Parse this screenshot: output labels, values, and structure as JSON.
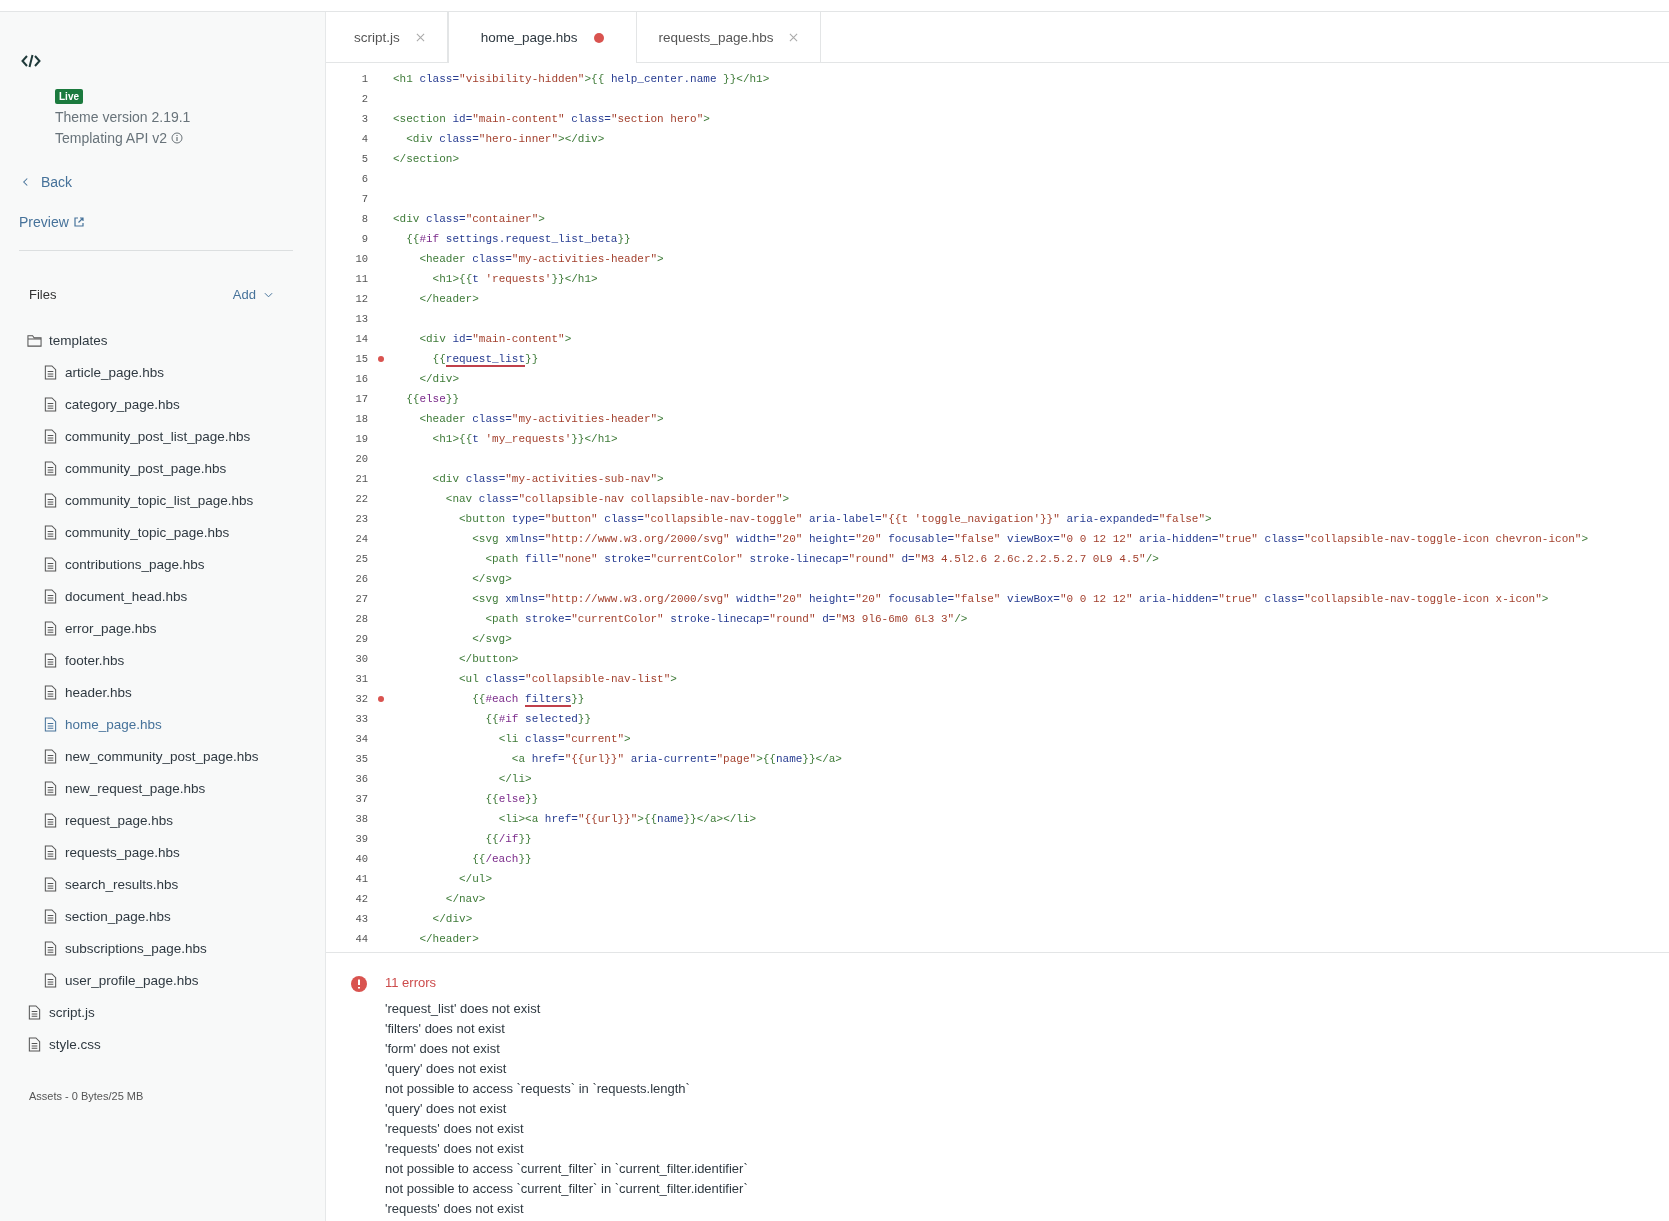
{
  "sidebar": {
    "badge": "Live",
    "theme_version": "Theme version 2.19.1",
    "api": "Templating API v2",
    "back": "Back",
    "preview": "Preview",
    "files": {
      "label": "Files",
      "add": "Add",
      "tree": [
        {
          "name": "templates",
          "kind": "folder",
          "selected": false,
          "children": [
            {
              "name": "article_page.hbs",
              "kind": "file",
              "selected": false
            },
            {
              "name": "category_page.hbs",
              "kind": "file",
              "selected": false
            },
            {
              "name": "community_post_list_page.hbs",
              "kind": "file",
              "selected": false
            },
            {
              "name": "community_post_page.hbs",
              "kind": "file",
              "selected": false
            },
            {
              "name": "community_topic_list_page.hbs",
              "kind": "file",
              "selected": false
            },
            {
              "name": "community_topic_page.hbs",
              "kind": "file",
              "selected": false
            },
            {
              "name": "contributions_page.hbs",
              "kind": "file",
              "selected": false
            },
            {
              "name": "document_head.hbs",
              "kind": "file",
              "selected": false
            },
            {
              "name": "error_page.hbs",
              "kind": "file",
              "selected": false
            },
            {
              "name": "footer.hbs",
              "kind": "file",
              "selected": false
            },
            {
              "name": "header.hbs",
              "kind": "file",
              "selected": false
            },
            {
              "name": "home_page.hbs",
              "kind": "file",
              "selected": true
            },
            {
              "name": "new_community_post_page.hbs",
              "kind": "file",
              "selected": false
            },
            {
              "name": "new_request_page.hbs",
              "kind": "file",
              "selected": false
            },
            {
              "name": "request_page.hbs",
              "kind": "file",
              "selected": false
            },
            {
              "name": "requests_page.hbs",
              "kind": "file",
              "selected": false
            },
            {
              "name": "search_results.hbs",
              "kind": "file",
              "selected": false
            },
            {
              "name": "section_page.hbs",
              "kind": "file",
              "selected": false
            },
            {
              "name": "subscriptions_page.hbs",
              "kind": "file",
              "selected": false
            },
            {
              "name": "user_profile_page.hbs",
              "kind": "file",
              "selected": false
            }
          ]
        },
        {
          "name": "script.js",
          "kind": "file",
          "selected": false
        },
        {
          "name": "style.css",
          "kind": "file",
          "selected": false
        }
      ]
    },
    "assets": "Assets - 0 Bytes/25 MB"
  },
  "tabs": [
    {
      "label": "script.js",
      "selected": false,
      "modified": false
    },
    {
      "label": "home_page.hbs",
      "selected": true,
      "modified": true
    },
    {
      "label": "requests_page.hbs",
      "selected": false,
      "modified": false
    }
  ],
  "editor": {
    "lines": [
      {
        "number": "1",
        "kind": "plain",
        "code": "<h1 class=\"visibility-hidden\">{{ help_center.name }}</h1>"
      },
      {
        "number": "2",
        "kind": "plain"
      },
      {
        "number": "3",
        "kind": "plain",
        "code": "<section id=\"main-content\" class=\"section hero\">"
      },
      {
        "number": "4",
        "kind": "plain",
        "code": "  <div class=\"hero-inner\"></div>"
      },
      {
        "number": "5",
        "kind": "plain",
        "code": "</section>"
      },
      {
        "number": "6",
        "kind": "plain"
      },
      {
        "number": "7",
        "kind": "plain"
      },
      {
        "number": "8",
        "kind": "plain",
        "code": "<div class=\"container\">"
      },
      {
        "number": "9",
        "kind": "plain",
        "code": "  {{#if settings.request_list_beta}}"
      },
      {
        "number": "10",
        "kind": "plain",
        "code": "    <header class=\"my-activities-header\">"
      },
      {
        "number": "11",
        "kind": "plain",
        "code": "      <h1>{{t 'requests'}}</h1>"
      },
      {
        "number": "12",
        "kind": "plain",
        "code": "    </header>"
      },
      {
        "number": "13",
        "kind": "plain"
      },
      {
        "number": "14",
        "kind": "plain",
        "code": "    <div id=\"main-content\">"
      },
      {
        "number": "15",
        "kind": "error",
        "code": "      {{",
        "flagged": "request_list",
        "code_after": "}}"
      },
      {
        "number": "16",
        "kind": "plain",
        "code": "    </div>"
      },
      {
        "number": "17",
        "kind": "plain",
        "code": "  {{else}}"
      },
      {
        "number": "18",
        "kind": "plain",
        "code": "    <header class=\"my-activities-header\">"
      },
      {
        "number": "19",
        "kind": "plain",
        "code": "      <h1>{{t 'my_requests'}}</h1>"
      },
      {
        "number": "20",
        "kind": "plain"
      },
      {
        "number": "21",
        "kind": "plain",
        "code": "      <div class=\"my-activities-sub-nav\">"
      },
      {
        "number": "22",
        "kind": "plain",
        "code": "        <nav class=\"collapsible-nav collapsible-nav-border\">"
      },
      {
        "number": "23",
        "kind": "plain",
        "code": "          <button type=\"button\" class=\"collapsible-nav-toggle\" aria-label=\"{{t 'toggle_navigation'}}\" aria-expanded=\"false\">"
      },
      {
        "number": "24",
        "kind": "plain",
        "code": "            <svg xmlns=\"http://www.w3.org/2000/svg\" width=\"20\" height=\"20\" focusable=\"false\" viewBox=\"0 0 12 12\" aria-hidden=\"true\" class=\"collapsible-nav-toggle-icon chevron-icon\">"
      },
      {
        "number": "25",
        "kind": "plain",
        "code": "              <path fill=\"none\" stroke=\"currentColor\" stroke-linecap=\"round\" d=\"M3 4.5l2.6 2.6c.2.2.5.2.7 0L9 4.5\"/>"
      },
      {
        "number": "26",
        "kind": "plain",
        "code": "            </svg>"
      },
      {
        "number": "27",
        "kind": "plain",
        "code": "            <svg xmlns=\"http://www.w3.org/2000/svg\" width=\"20\" height=\"20\" focusable=\"false\" viewBox=\"0 0 12 12\" aria-hidden=\"true\" class=\"collapsible-nav-toggle-icon x-icon\">"
      },
      {
        "number": "28",
        "kind": "plain",
        "code": "              <path stroke=\"currentColor\" stroke-linecap=\"round\" d=\"M3 9l6-6m0 6L3 3\"/>"
      },
      {
        "number": "29",
        "kind": "plain",
        "code": "            </svg>"
      },
      {
        "number": "30",
        "kind": "plain",
        "code": "          </button>"
      },
      {
        "number": "31",
        "kind": "plain",
        "code": "          <ul class=\"collapsible-nav-list\">"
      },
      {
        "number": "32",
        "kind": "error",
        "code": "            {{#each ",
        "flagged": "filters",
        "code_after": "}}"
      },
      {
        "number": "33",
        "kind": "plain",
        "code": "              {{#if selected}}"
      },
      {
        "number": "34",
        "kind": "plain",
        "code": "                <li class=\"current\">"
      },
      {
        "number": "35",
        "kind": "plain",
        "code": "                  <a href=\"{{url}}\" aria-current=\"page\">{{name}}</a>"
      },
      {
        "number": "36",
        "kind": "plain",
        "code": "                </li>"
      },
      {
        "number": "37",
        "kind": "plain",
        "code": "              {{else}}"
      },
      {
        "number": "38",
        "kind": "plain",
        "code": "                <li><a href=\"{{url}}\">{{name}}</a></li>"
      },
      {
        "number": "39",
        "kind": "plain",
        "code": "              {{/if}}"
      },
      {
        "number": "40",
        "kind": "plain",
        "code": "            {{/each}}"
      },
      {
        "number": "41",
        "kind": "plain",
        "code": "          </ul>"
      },
      {
        "number": "42",
        "kind": "plain",
        "code": "        </nav>"
      },
      {
        "number": "43",
        "kind": "plain",
        "code": "      </div>"
      },
      {
        "number": "44",
        "kind": "plain",
        "code": "    </header>"
      }
    ]
  },
  "errors": {
    "title": "11 errors",
    "items": [
      "'request_list' does not exist",
      "'filters' does not exist",
      "'form' does not exist",
      "'query' does not exist",
      "not possible to access `requests` in `requests.length`",
      "'query' does not exist",
      "'requests' does not exist",
      "'requests' does not exist",
      "not possible to access `current_filter` in `current_filter.identifier`",
      "not possible to access `current_filter` in `current_filter.identifier`",
      "'requests' does not exist"
    ]
  }
}
